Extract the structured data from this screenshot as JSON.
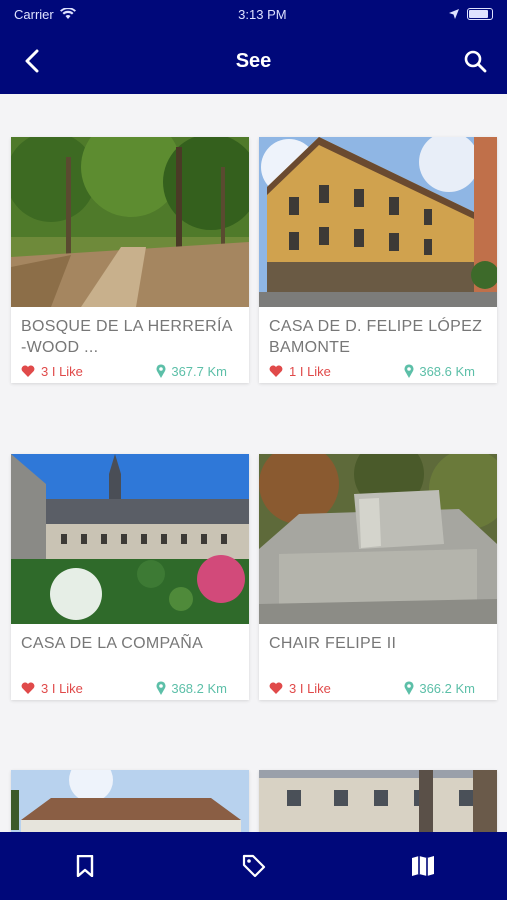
{
  "status_bar": {
    "carrier": "Carrier",
    "time": "3:13 PM"
  },
  "header": {
    "title": "See",
    "back_icon": "chevron-left-icon",
    "search_icon": "search-icon"
  },
  "places": [
    {
      "name": "BOSQUE DE LA HERRERÍA -WOOD ...",
      "likes": "3 I Like",
      "distance": "367.7 Km"
    },
    {
      "name": "CASA DE D. FELIPE LÓPEZ BAMONTE",
      "likes": "1 I Like",
      "distance": "368.6 Km"
    },
    {
      "name": "CASA DE LA COMPAÑA",
      "likes": "3 I Like",
      "distance": "368.2 Km"
    },
    {
      "name": "CHAIR FELIPE II",
      "likes": "3 I Like",
      "distance": "366.2 Km"
    },
    {
      "name": "",
      "likes": "",
      "distance": ""
    },
    {
      "name": "",
      "likes": "",
      "distance": ""
    }
  ],
  "tab_bar": {
    "items": [
      "bookmark-icon",
      "tag-icon",
      "map-icon"
    ]
  },
  "colors": {
    "header": "#00087a",
    "like": "#e04a4a",
    "distance": "#5cbfa8",
    "text": "#777777"
  }
}
